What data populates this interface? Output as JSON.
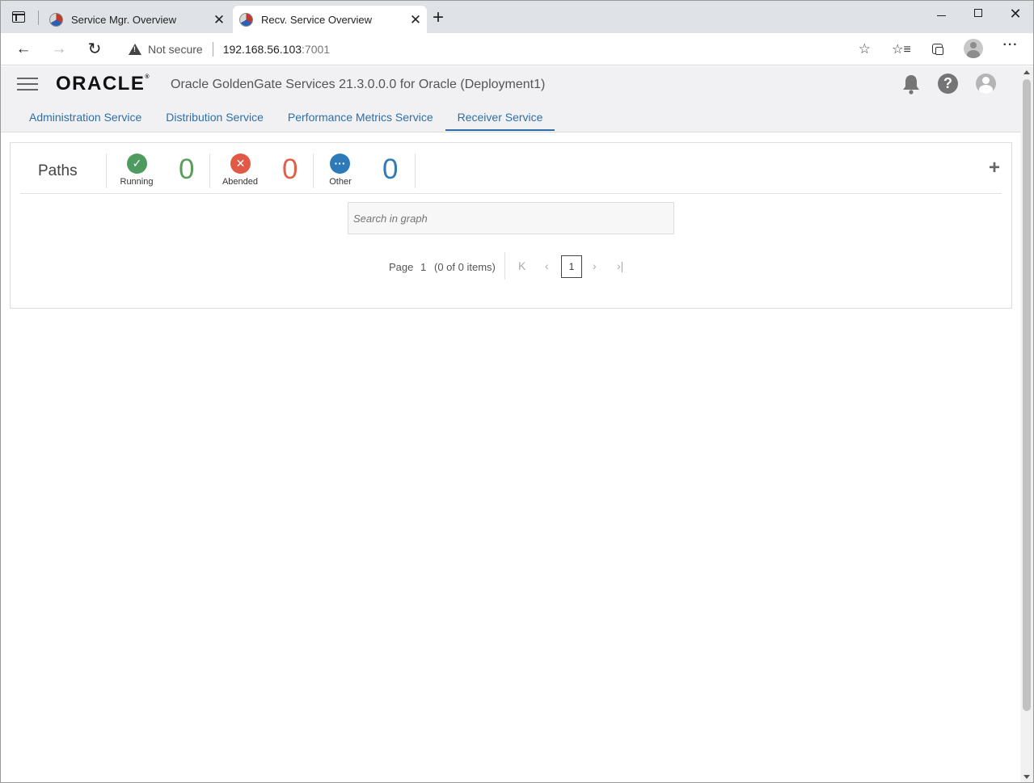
{
  "browser": {
    "tabs": [
      {
        "title": "Service Mgr. Overview",
        "active": false
      },
      {
        "title": "Recv. Service Overview",
        "active": true
      }
    ],
    "address": {
      "security_label": "Not secure",
      "host": "192.168.56.103",
      "port": ":7001"
    }
  },
  "app": {
    "logo_text": "ORACLE",
    "logo_mark": "®",
    "title": "Oracle GoldenGate Services 21.3.0.0.0 for Oracle (Deployment1)",
    "nav_tabs": [
      {
        "label": "Administration Service",
        "active": false
      },
      {
        "label": "Distribution Service",
        "active": false
      },
      {
        "label": "Performance Metrics Service",
        "active": false
      },
      {
        "label": "Receiver Service",
        "active": true
      }
    ]
  },
  "paths": {
    "heading": "Paths",
    "stats": [
      {
        "label": "Running",
        "count": "0",
        "color": "#4d9b5f"
      },
      {
        "label": "Abended",
        "count": "0",
        "color": "#e05a45"
      },
      {
        "label": "Other",
        "count": "0",
        "color": "#2d7ab8"
      }
    ],
    "search_placeholder": "Search in graph",
    "pager": {
      "label": "Page",
      "page": "1",
      "items": "(0 of 0 items)",
      "current": "1"
    }
  }
}
